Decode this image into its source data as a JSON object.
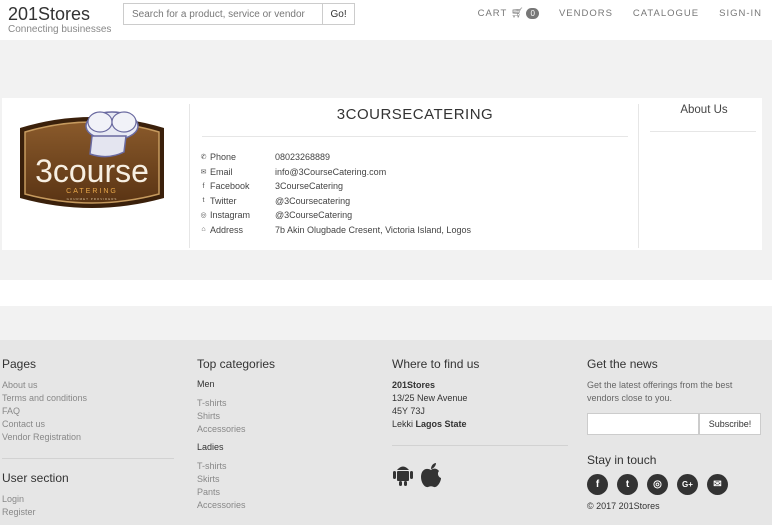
{
  "header": {
    "brand": "201Stores",
    "tagline": "Connecting businesses",
    "search_placeholder": "Search for a product, service or vendor",
    "search_button": "Go!",
    "nav": {
      "cart": "CART",
      "cart_count": "0",
      "vendors": "VENDORS",
      "catalogue": "CATALOGUE",
      "signin": "SIGN-IN"
    }
  },
  "vendor": {
    "name": "3COURSECATERING",
    "logo": {
      "main": "3course",
      "sub": "CATERING",
      "tiny": "GOURMET PROVIDERS"
    },
    "contacts": [
      {
        "icon": "phone-icon",
        "label": "Phone",
        "value": "08023268889"
      },
      {
        "icon": "envelope-icon",
        "label": "Email",
        "value": "info@3CourseCatering.com"
      },
      {
        "icon": "facebook-icon",
        "label": "Facebook",
        "value": "3CourseCatering"
      },
      {
        "icon": "twitter-icon",
        "label": "Twitter",
        "value": "@3Coursecatering"
      },
      {
        "icon": "instagram-icon",
        "label": "Instagram",
        "value": "@3CourseCatering"
      },
      {
        "icon": "home-icon",
        "label": "Address",
        "value": "7b Akin Olugbade Cresent, Victoria Island, Logos"
      }
    ],
    "about_title": "About Us"
  },
  "footer": {
    "pages": {
      "title": "Pages",
      "links": [
        "About us",
        "Terms and conditions",
        "FAQ",
        "Contact us",
        "Vendor Registration"
      ]
    },
    "user_section": {
      "title": "User section",
      "links": [
        "Login",
        "Register"
      ]
    },
    "top_categories": {
      "title": "Top categories",
      "men": {
        "title": "Men",
        "items": [
          "T-shirts",
          "Shirts",
          "Accessories"
        ]
      },
      "ladies": {
        "title": "Ladies",
        "items": [
          "T-shirts",
          "Skirts",
          "Pants",
          "Accessories"
        ]
      }
    },
    "find_us": {
      "title": "Where to find us",
      "company": "201Stores",
      "line1": "13/25 New Avenue",
      "line2": "45Y 73J",
      "city": "Lekki",
      "state": "Lagos State"
    },
    "news": {
      "title": "Get the news",
      "text": "Get the latest offerings from the best vendors close to you.",
      "subscribe": "Subscribe!"
    },
    "stay": {
      "title": "Stay in touch",
      "icons": [
        "facebook-icon",
        "twitter-icon",
        "instagram-icon",
        "google-plus-icon",
        "envelope-icon"
      ]
    },
    "copyright": "© 2017 201Stores"
  }
}
